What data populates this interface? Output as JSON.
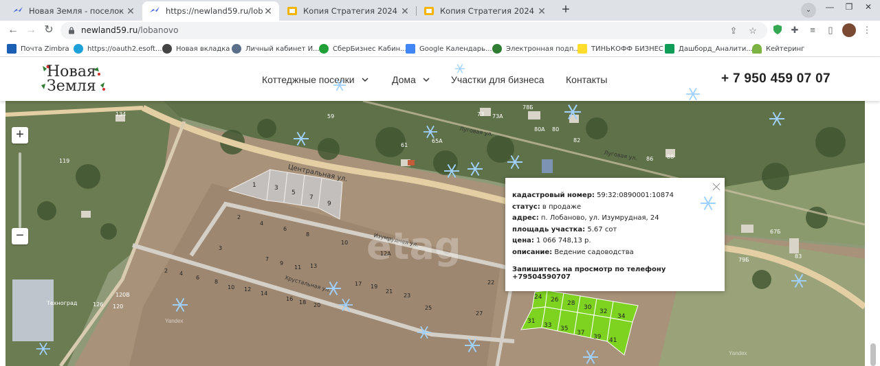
{
  "browser": {
    "tabs": [
      {
        "title": "Новая Земля - поселок КРП - за",
        "active": false
      },
      {
        "title": "https://newland59.ru/lobanovo",
        "active": true
      },
      {
        "title": "Копия Стратегия 2024 - Google",
        "active": false
      },
      {
        "title": "Копия Стратегия 2024 - Google",
        "active": false
      }
    ],
    "new_tab": "+",
    "url_domain": "newland59.ru",
    "url_path": "/lobanovo",
    "bookmarks": [
      {
        "label": "Почта Zimbra",
        "color": "#1a5fb4"
      },
      {
        "label": "https://oauth2.esoft...",
        "color": "#1ea0d8"
      },
      {
        "label": "Новая вкладка",
        "color": "#444444"
      },
      {
        "label": "Личный кабинет И...",
        "color": "#5b6f8a"
      },
      {
        "label": "СберБизнес Кабин...",
        "color": "#21a038"
      },
      {
        "label": "Google Календарь...",
        "color": "#4285f4"
      },
      {
        "label": "Электронная подп...",
        "color": "#2e7d32"
      },
      {
        "label": "ТИНЬКОФФ БИЗНЕС",
        "color": "#ffdd2d"
      },
      {
        "label": "Дашборд_Аналити...",
        "color": "#0f9d58"
      },
      {
        "label": "Кейтеринг",
        "color": "#7cb342"
      }
    ]
  },
  "site": {
    "logo_line1": "Новая",
    "logo_line2": "Земля",
    "nav": [
      {
        "label": "Коттеджные поселки",
        "dropdown": true
      },
      {
        "label": "Дома",
        "dropdown": true
      },
      {
        "label": "Участки для бизнеса",
        "dropdown": false
      },
      {
        "label": "Контакты",
        "dropdown": false
      }
    ],
    "phone": "+ 7 950 459 07 07"
  },
  "map": {
    "zoom_in": "+",
    "zoom_out": "−",
    "streets": [
      "Центральная ул.",
      "Изумрудная ул.",
      "Хрустальная ул.",
      "Луговая ул.",
      "Луговая ул."
    ],
    "area_labels": [
      "Техноград"
    ],
    "watermark": "etag",
    "sold_plots": [
      "1",
      "3",
      "5",
      "7",
      "9"
    ],
    "available_plots": [
      "24",
      "26",
      "28",
      "30",
      "32",
      "34",
      "31",
      "33",
      "35",
      "37",
      "39",
      "41"
    ],
    "field_plots": [
      "2",
      "4",
      "6",
      "8",
      "10",
      "12А",
      "3",
      "7",
      "9",
      "11",
      "13",
      "2",
      "4",
      "6",
      "8",
      "10",
      "12",
      "14",
      "16",
      "18",
      "20",
      "22",
      "17",
      "19",
      "21",
      "23",
      "25",
      "27"
    ],
    "house_numbers": [
      "59",
      "61",
      "65А",
      "73А",
      "73",
      "78Б",
      "80А",
      "80",
      "82",
      "86",
      "88",
      "134",
      "119",
      "126",
      "120В",
      "120",
      "67Б",
      "79Б",
      "83"
    ],
    "yandex": "Yandex"
  },
  "popup": {
    "rows": [
      {
        "label": "кадастровый номер:",
        "value": "59:32:0890001:10874"
      },
      {
        "label": "статус:",
        "value": "в продаже"
      },
      {
        "label": "адрес:",
        "value": "п. Лобаново, ул. Изумрудная, 24"
      },
      {
        "label": "площадь участка:",
        "value": "5.67 сот"
      },
      {
        "label": "цена:",
        "value": "1 066 748,13 р."
      },
      {
        "label": "описание:",
        "value": "Ведение садоводства"
      }
    ],
    "cta": "Запишитесь на просмотр по телефону +79504590707"
  },
  "colors": {
    "available_plot": "#7ed321",
    "sold_plot": "#c8c8c8",
    "snowflake": "#9fd0ff"
  }
}
